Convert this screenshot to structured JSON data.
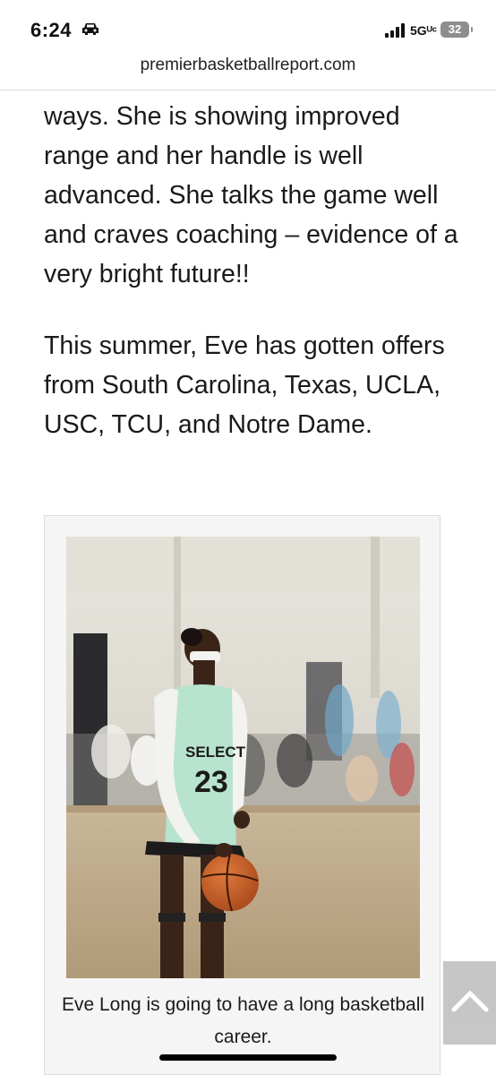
{
  "status_bar": {
    "time": "6:24",
    "network": "5Gᵁᶜ",
    "battery": "32",
    "icons": [
      "car-icon",
      "signal-icon"
    ]
  },
  "browser": {
    "url": "premierbasketballreport.com"
  },
  "article": {
    "paragraph_1": "ways. She is showing improved range and her handle is well advanced. She talks the game well and craves coaching – evidence of a very bright future!!",
    "paragraph_2": "This summer, Eve has gotten offers from South Carolina, Texas, UCLA, USC, TCU, and Notre Dame."
  },
  "figure": {
    "jersey_text": "SELECT",
    "jersey_number": "23",
    "caption": "Eve Long is going to have a long basketball career."
  },
  "controls": {
    "scroll_top_icon": "chevron-up-icon"
  }
}
